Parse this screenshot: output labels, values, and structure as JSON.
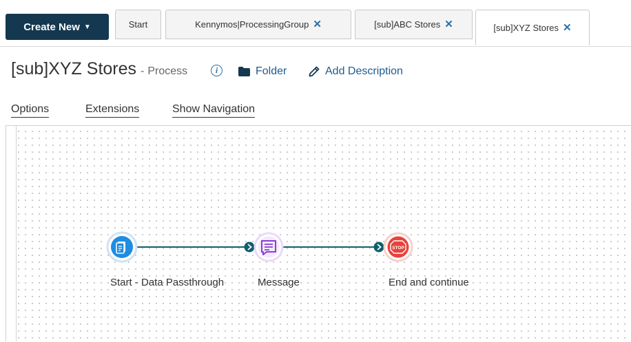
{
  "toolbar": {
    "create_label": "Create New"
  },
  "tabs": [
    {
      "label": "Start"
    },
    {
      "label": "Kennymos|ProcessingGroup"
    },
    {
      "label": "[sub]ABC Stores"
    },
    {
      "label": "[sub]XYZ Stores"
    }
  ],
  "close_glyph": "✕",
  "header": {
    "title": "[sub]XYZ Stores",
    "separator": "-",
    "type": "Process",
    "info_glyph": "i",
    "folder_label": "Folder",
    "description_label": "Add Description"
  },
  "subnav": {
    "options": "Options",
    "extensions": "Extensions",
    "navigation": "Show Navigation"
  },
  "process": {
    "shapes": [
      {
        "label": "Start - Data Passthrough",
        "icon": "document-icon",
        "color": "#1f8de0"
      },
      {
        "label": "Message",
        "icon": "message-icon",
        "color": "#8a3fd1"
      },
      {
        "label": "End and continue",
        "icon": "stop-icon",
        "color": "#e8423c",
        "badge": "STOP"
      }
    ],
    "connector_color": "#0e5f6b"
  }
}
